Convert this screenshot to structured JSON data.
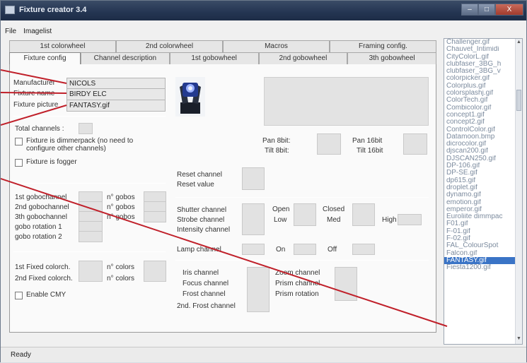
{
  "window": {
    "title": "Fixture creator 3.4",
    "min": "–",
    "max": "□",
    "close": "X"
  },
  "menu": [
    "File",
    "Imagelist"
  ],
  "tabs_row1": [
    "1st colorwheel",
    "2nd colorwheel",
    "Macros",
    "Framing config."
  ],
  "tabs_row2": [
    "Fixture config",
    "Channel description",
    "1st gobowheel",
    "2nd gobowheel",
    "3th gobowheel"
  ],
  "fixture": {
    "manufacturer_label": "Manufacturer",
    "manufacturer": "NICOLS",
    "name_label": "Fixture name",
    "name": "BIRDY ELC",
    "picture_label": "Fixture picture",
    "picture": "FANTASY.gif",
    "total_channels": "Total channels :",
    "dimmerpack": "Fixture is dimmerpack (no need to",
    "dimmerpack2": "configure other channels)",
    "fogger": "Fixture is fogger"
  },
  "pan": {
    "pan8": "Pan 8bit:",
    "tilt8": "Tilt 8bit:",
    "pan16": "Pan 16bit",
    "tilt16": "Tilt 16bit"
  },
  "reset": {
    "channel": "Reset channel",
    "value": "Reset value"
  },
  "gobos": {
    "g1": "1st gobochannel",
    "g2": "2nd gobochannel",
    "g3": "3th gobochannel",
    "r1": "gobo rotation 1",
    "r2": "gobo rotation 2",
    "n1": "n° gobos",
    "n2": "n° gobos",
    "n3": "n° gobos"
  },
  "shutter": {
    "shutter": "Shutter channel",
    "strobe": "Strobe channel",
    "intensity": "Intensity channel",
    "open": "Open",
    "closed": "Closed",
    "low": "Low",
    "med": "Med",
    "high": "High"
  },
  "lamp": {
    "label": "Lamp channel",
    "on": "On",
    "off": "Off"
  },
  "colors": {
    "c1": "1st Fixed colorch.",
    "c2": "2nd Fixed colorch.",
    "n1": "n° colors",
    "n2": "n° colors",
    "cmy": "Enable CMY"
  },
  "optics": {
    "iris": "Iris channel",
    "focus": "Focus channel",
    "frost": "Frost channel",
    "frost2": "2nd. Frost channel",
    "zoom": "Zoom channel",
    "prism": "Prism channel",
    "prismrot": "Prism rotation"
  },
  "files": [
    "Challenger.gif",
    "Chauvet_Intimidi",
    "CityColorL.gif",
    "clubfaser_3BG_h",
    "clubfaser_3BG_v",
    "colorpicker.gif",
    "Colorplus.gif",
    "colorsplashj.gif",
    "ColorTech.gif",
    "Combicolor.gif",
    "concept1.gif",
    "concept2.gif",
    "ControlColor.gif",
    "Datamoon.bmp",
    "dicrocolor.gif",
    "djscan200.gif",
    "DJSCAN250.gif",
    "DP-106.gif",
    "DP-SE.gif",
    "dp615.gif",
    "droplet.gif",
    "dynamo.gif",
    "emotion.gif",
    "emperor.gif",
    "Euroliite dimmpac",
    "F01.gif",
    "F-01.gif",
    "F-02.gif",
    "FAL_ColourSpot",
    "Falcon.gif",
    "FANTASY.gif",
    "Fiesta1200.gif"
  ],
  "selected_file": "FANTASY.gif",
  "status": "Ready",
  "colors_ui": {
    "accent": "#3a74c6",
    "callout": "#c0202a",
    "titlebar": "#243552"
  }
}
